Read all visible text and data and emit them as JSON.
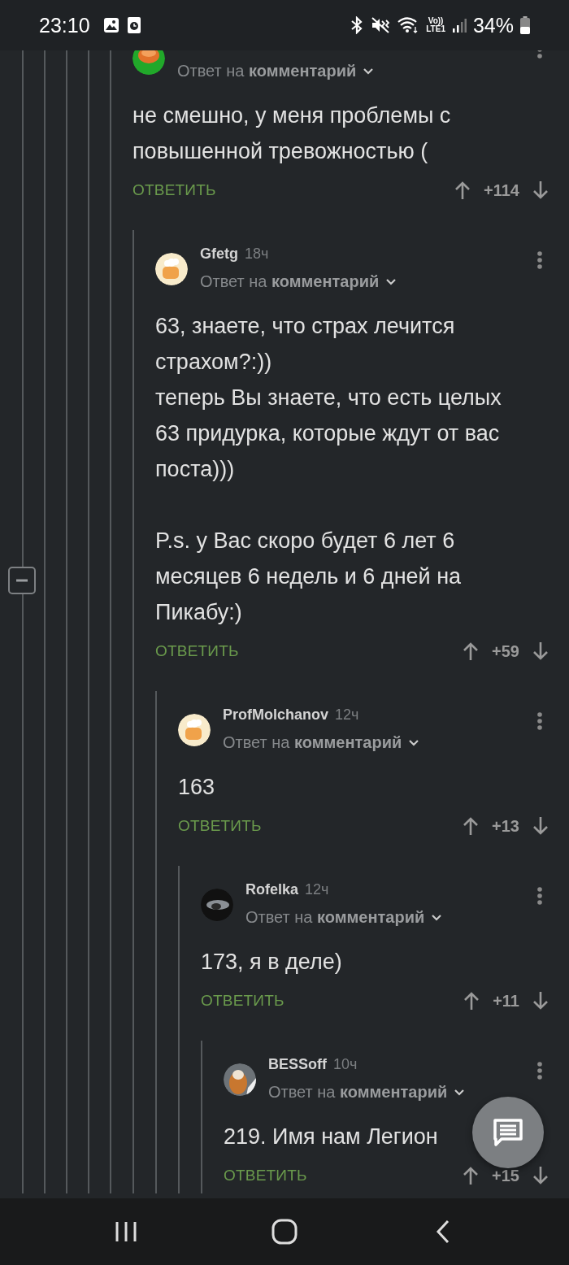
{
  "status_bar": {
    "time": "23:10",
    "volte_top": "Vo))",
    "volte_bottom": "LTE1",
    "battery": "34%"
  },
  "collapse_button": {
    "expanded": true
  },
  "comments": [
    {
      "avatar": {
        "kind": "green-photo"
      },
      "reply_to": "Ответ на **комментарий**",
      "text": "не смешно, у меня проблемы с повышенной тревожностью (",
      "reply_label": "ОТВЕТИТЬ",
      "score": "+114",
      "children": [
        {
          "author": "Gfetg",
          "time": "18ч",
          "avatar": {
            "kind": "chef-default"
          },
          "reply_to": "Ответ на **комментарий**",
          "text": "63, знаете, что страх лечится страхом?:))\nтеперь Вы знаете, что есть целых 63 придурка, которые ждут от вас поста)))\n\nP.s. у Вас скоро будет 6 лет 6 месяцев 6 недель и 6 дней на Пикабу:)",
          "reply_label": "ОТВЕТИТЬ",
          "score": "+59",
          "children": [
            {
              "author": "ProfMolchanov",
              "time": "12ч",
              "avatar": {
                "kind": "chef-default"
              },
              "reply_to": "Ответ на **комментарий**",
              "text": "163",
              "reply_label": "ОТВЕТИТЬ",
              "score": "+13",
              "children": [
                {
                  "author": "Rofelka",
                  "time": "12ч",
                  "avatar": {
                    "kind": "dark-photo"
                  },
                  "reply_to": "Ответ на **комментарий**",
                  "text": "173, я в деле)",
                  "reply_label": "ОТВЕТИТЬ",
                  "score": "+11",
                  "children": [
                    {
                      "author": "BESSoff",
                      "time": "10ч",
                      "avatar": {
                        "kind": "tiger-photo"
                      },
                      "reply_to": "Ответ на **комментарий**",
                      "text": "219. Имя нам Легион",
                      "reply_label": "ОТВЕТИТЬ",
                      "score": "+15"
                    }
                  ]
                }
              ]
            }
          ]
        }
      ]
    }
  ]
}
